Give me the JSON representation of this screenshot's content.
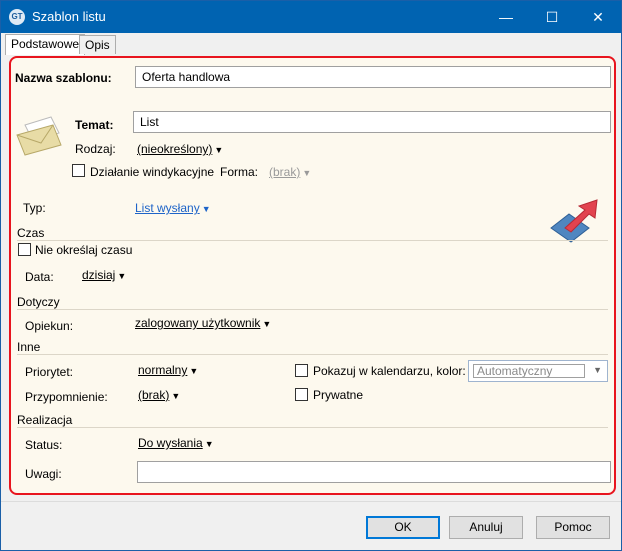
{
  "window": {
    "title": "Szablon listu",
    "minimize": "—",
    "maximize": "☐",
    "close": "✕"
  },
  "tabs": [
    {
      "label": "Podstawowe",
      "active": true
    },
    {
      "label": "Opis",
      "active": false
    }
  ],
  "form": {
    "nazwa_label": "Nazwa szablonu:",
    "nazwa_value": "Oferta handlowa",
    "temat_label": "Temat:",
    "temat_value": "List",
    "rodzaj_label": "Rodzaj:",
    "rodzaj_value": "(nieokreślony)",
    "windykacja_label": "Działanie windykacyjne",
    "windykacja_checked": false,
    "forma_label": "Forma:",
    "forma_value": "(brak)",
    "typ_label": "Typ:",
    "typ_value": "List wysłany",
    "czas_section": "Czas",
    "nie_okreslaj_label": "Nie określaj czasu",
    "nie_okreslaj_checked": false,
    "data_label": "Data:",
    "data_value": "dzisiaj",
    "dotyczy_section": "Dotyczy",
    "opiekun_label": "Opiekun:",
    "opiekun_value": "zalogowany użytkownik",
    "inne_section": "Inne",
    "priorytet_label": "Priorytet:",
    "priorytet_value": "normalny",
    "kalendarz_label": "Pokazuj w kalendarzu, kolor:",
    "kalendarz_checked": false,
    "kolor_value": "Automatyczny",
    "przypomnienie_label": "Przypomnienie:",
    "przypomnienie_value": "(brak)",
    "prywatne_label": "Prywatne",
    "prywatne_checked": false,
    "realizacja_section": "Realizacja",
    "status_label": "Status:",
    "status_value": "Do wysłania",
    "uwagi_label": "Uwagi:",
    "uwagi_value": ""
  },
  "buttons": {
    "ok": "OK",
    "cancel": "Anuluj",
    "help": "Pomoc"
  },
  "colors": {
    "titlebar": "#0063b1",
    "panel_border": "#e8141e",
    "panel_bg": "#fdf9ee",
    "link_blue": "#1e64c8"
  }
}
